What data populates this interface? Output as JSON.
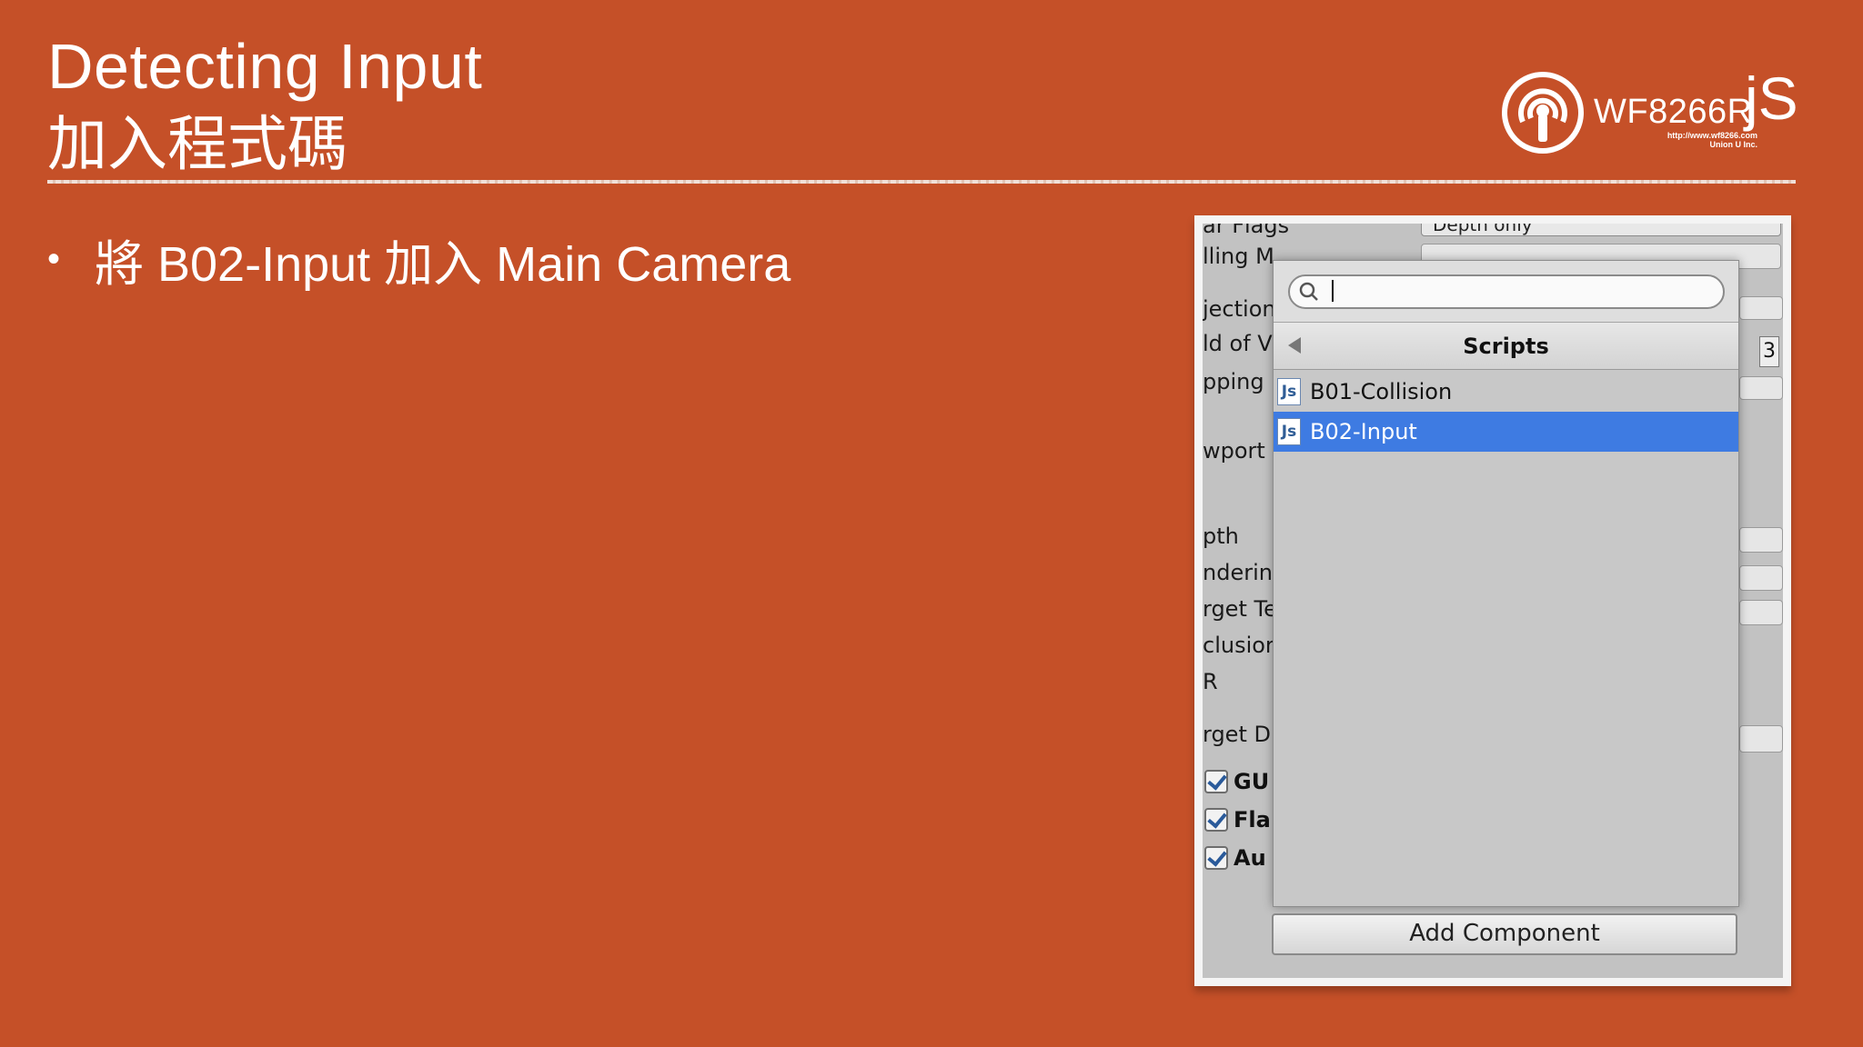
{
  "slide": {
    "title": "Detecting Input",
    "title_cn": "加入程式碼",
    "bullet": "將 B02-Input 加入 Main Camera"
  },
  "logo": {
    "brand": "WF8266R",
    "brand_suffix": "jS",
    "url_line1": "http://www.wf8266.com",
    "url_line2": "Union U Inc."
  },
  "inspector": {
    "labels": [
      "ar Flags",
      "lling M",
      "jection",
      "ld of V",
      "pping I",
      "wport",
      "pth",
      "nderin",
      "rget Te",
      "clusior",
      "R",
      "rget Di"
    ],
    "depth_value": "Depth only",
    "side_number": "3",
    "checkboxes": [
      "GU",
      "Fla",
      "Au"
    ]
  },
  "popup": {
    "search_value": "",
    "header_title": "Scripts",
    "items": [
      {
        "label": "B01-Collision",
        "icon": "js-script-icon",
        "selected": false
      },
      {
        "label": "B02-Input",
        "icon": "js-script-icon",
        "selected": true
      }
    ],
    "add_button": "Add Component"
  },
  "colors": {
    "background": "#c55028",
    "selection": "#3e7be2"
  }
}
